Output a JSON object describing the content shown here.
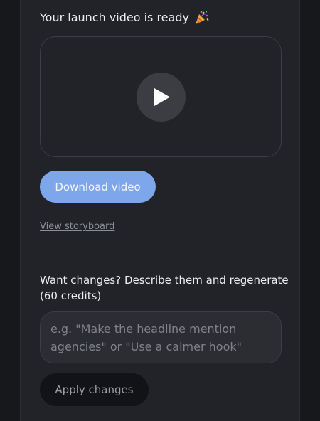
{
  "header": {
    "title": "Your launch video is ready",
    "title_icon": "party-popper-icon"
  },
  "video": {
    "play_icon": "play-icon"
  },
  "actions": {
    "download_label": "Download video",
    "storyboard_link": "View storyboard"
  },
  "changes": {
    "heading": "Want changes? Describe them and regenerate (60 credits)",
    "placeholder": "e.g. \"Make the headline mention agencies\" or \"Use a calmer hook\"",
    "value": "",
    "apply_label": "Apply changes"
  },
  "colors": {
    "accent": "#7da7ea",
    "panel_background": "#212328",
    "page_background": "#17181b"
  }
}
